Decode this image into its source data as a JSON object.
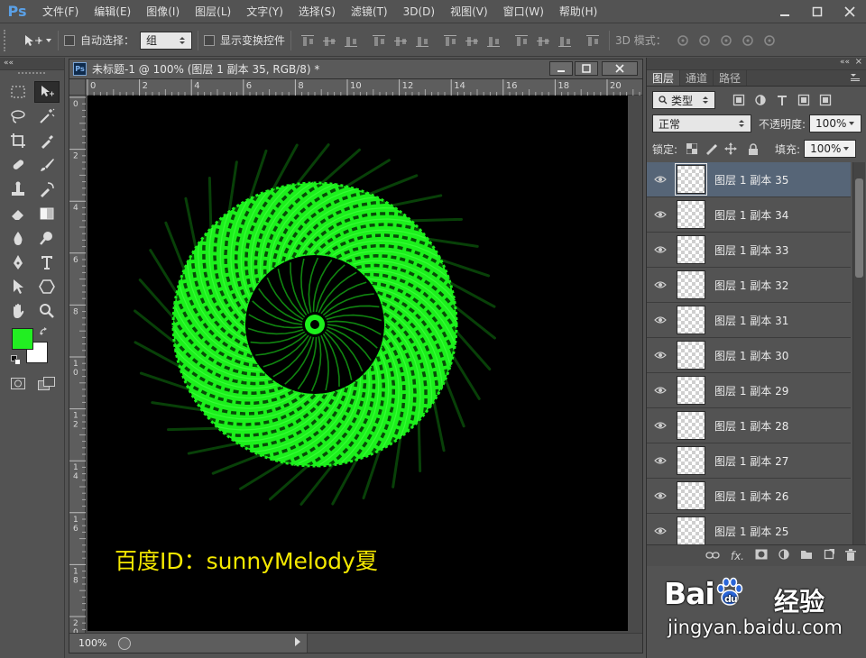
{
  "app": {
    "logo": "Ps",
    "menu": [
      "文件(F)",
      "编辑(E)",
      "图像(I)",
      "图层(L)",
      "文字(Y)",
      "选择(S)",
      "滤镜(T)",
      "3D(D)",
      "视图(V)",
      "窗口(W)",
      "帮助(H)"
    ],
    "window_controls": [
      "minimize-icon",
      "restore-icon",
      "close-icon"
    ]
  },
  "options": {
    "auto_select_label": "自动选择：",
    "auto_select_value": "组",
    "show_transform_label": "显示变换控件",
    "mode_3d_label": "3D 模式："
  },
  "tools": [
    "rect-marquee-icon",
    "move-tool-icon",
    "lasso-icon",
    "magic-wand-icon",
    "crop-icon",
    "eyedropper-icon",
    "healing-brush-icon",
    "brush-icon",
    "clone-stamp-icon",
    "history-brush-icon",
    "eraser-icon",
    "gradient-icon",
    "blur-icon",
    "dodge-icon",
    "pen-icon",
    "type-tool-icon",
    "path-select-icon",
    "shape-icon",
    "hand-icon",
    "zoom-icon"
  ],
  "colors": {
    "foreground": "#22ee22",
    "background": "#ffffff",
    "accent": "#566577",
    "spiral": "#1cf01c"
  },
  "document": {
    "title": "未标题-1 @ 100% (图层 1 副本 35, RGB/8) *",
    "ruler_h": [
      "0",
      "2",
      "4",
      "6",
      "8",
      "10",
      "12",
      "14",
      "16",
      "18",
      "20"
    ],
    "ruler_v": [
      "0",
      "2",
      "4",
      "6",
      "8",
      "1\n0",
      "1\n2",
      "1\n4",
      "1\n6",
      "1\n8",
      "2\n0"
    ],
    "canvas_text": "百度ID：sunnyMelody夏",
    "zoom": "100%"
  },
  "layers_panel": {
    "tabs": [
      "图层",
      "通道",
      "路径"
    ],
    "filter_label": "类型",
    "blend_mode": "正常",
    "opacity_label": "不透明度:",
    "opacity_value": "100%",
    "lock_label": "锁定:",
    "fill_label": "填充:",
    "fill_value": "100%",
    "layers": [
      {
        "name": "图层 1 副本 35",
        "selected": true
      },
      {
        "name": "图层 1 副本 34"
      },
      {
        "name": "图层 1 副本 33"
      },
      {
        "name": "图层 1 副本 32"
      },
      {
        "name": "图层 1 副本 31"
      },
      {
        "name": "图层 1 副本 30"
      },
      {
        "name": "图层 1 副本 29"
      },
      {
        "name": "图层 1 副本 28"
      },
      {
        "name": "图层 1 副本 27"
      },
      {
        "name": "图层 1 副本 26"
      },
      {
        "name": "图层 1 副本 25"
      }
    ]
  },
  "watermark": {
    "brand": "Bai",
    "brand2": "du",
    "brand_cn": "经验",
    "url": "jingyan.baidu.com"
  }
}
